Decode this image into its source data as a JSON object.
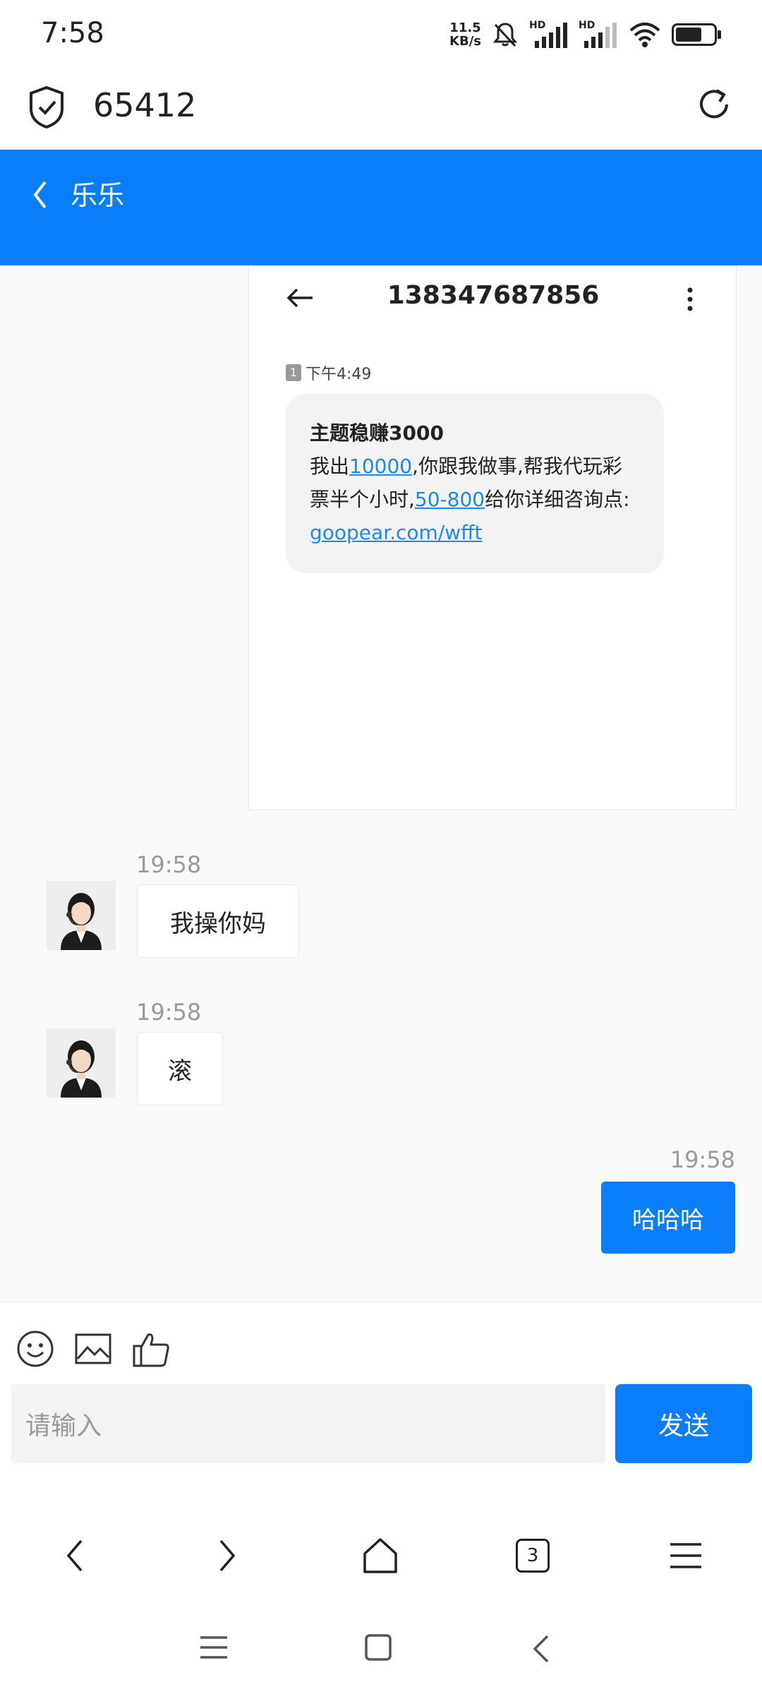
{
  "status_bar": {
    "time": "7:58",
    "net_speed_value": "11.5",
    "net_speed_unit": "KB/s",
    "signal1_label": "HD",
    "signal2_label": "HD",
    "battery_level": 0.7
  },
  "url_bar": {
    "url": "65412"
  },
  "chat_header": {
    "title": "乐乐"
  },
  "screenshot": {
    "phone_number": "138347687856",
    "sim": "1",
    "time": "下午4:49",
    "sms": {
      "line1": "主题稳赚3000",
      "part1": "我出",
      "link1": "10000",
      "part2": ",你跟我做事,帮我代玩彩票半个小时,",
      "link2": "50-800",
      "part3": "给你详细咨询点:",
      "link3": "goopear.com/wfft"
    }
  },
  "messages": [
    {
      "direction": "in",
      "time": "19:58",
      "text": "我操你妈"
    },
    {
      "direction": "in",
      "time": "19:58",
      "text": "滚"
    },
    {
      "direction": "out",
      "time": "19:58",
      "text": "哈哈哈"
    }
  ],
  "composer": {
    "placeholder": "请输入",
    "send_label": "发送"
  },
  "browser_nav": {
    "tab_count": "3"
  },
  "colors": {
    "accent": "#0a7dfa",
    "link": "#1e88e5"
  },
  "icons": [
    "shield-check-icon",
    "reload-icon",
    "back-chevron-icon",
    "arrow-left-icon",
    "more-vertical-icon",
    "emoji-icon",
    "image-icon",
    "thumbs-up-icon",
    "nav-back-icon",
    "nav-forward-icon",
    "home-icon",
    "tabs-icon",
    "menu-icon"
  ]
}
